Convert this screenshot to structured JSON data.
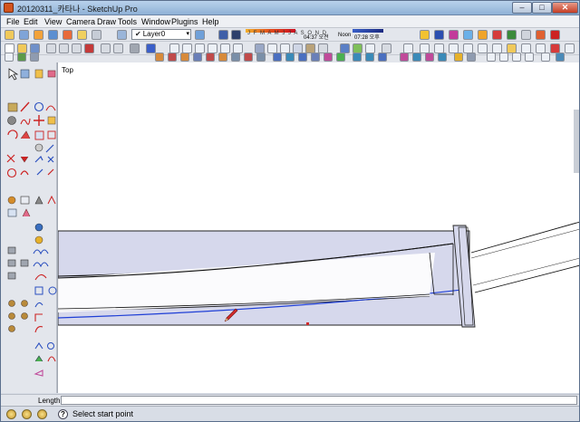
{
  "window": {
    "title": "20120311_카타나 - SketchUp Pro",
    "min_glyph": "‒",
    "max_glyph": "□",
    "close_glyph": "✕"
  },
  "menu": {
    "items": [
      "File",
      "Edit",
      "View",
      "Camera",
      "Draw",
      "Tools",
      "Window",
      "Plugins",
      "Help"
    ]
  },
  "layers": {
    "current": "Layer0",
    "check_glyph": "✔",
    "arrow_glyph": "▾"
  },
  "shadows": {
    "months": "J F M A M J J A S O N D",
    "time_start": "04:37 오전",
    "time_noon": "Noon",
    "time_end": "07:28 오후"
  },
  "viewport": {
    "scene_label": "Top"
  },
  "measurements": {
    "label": "Length",
    "value": ""
  },
  "status": {
    "help_glyph": "?",
    "message": "Select start point"
  },
  "colors": {
    "accent": "#1f3fd6",
    "blade_fill": "#d6d8ec",
    "cursor": "#d12a2a"
  }
}
